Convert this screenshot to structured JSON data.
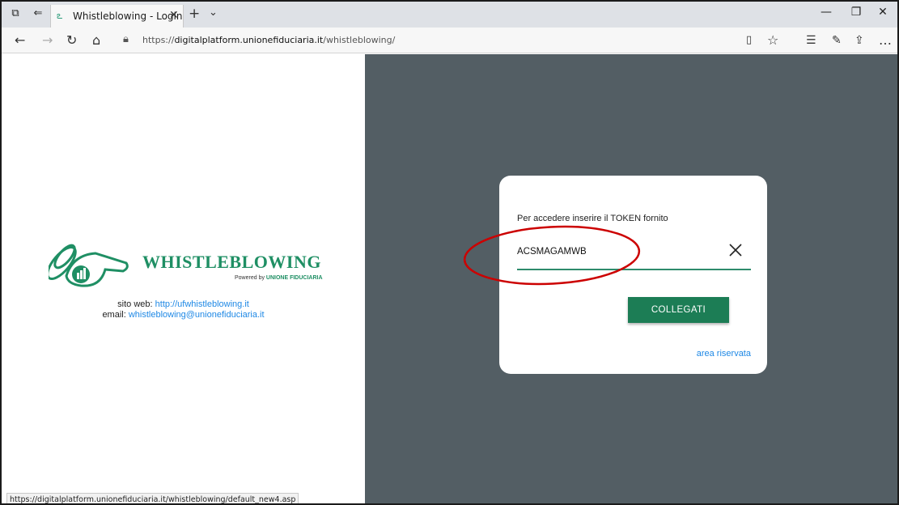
{
  "browser": {
    "tab_title": "Whistleblowing - Login",
    "url_prefix": "https://",
    "url_host": "digitalplatform.unionefiduciaria.it",
    "url_path": "/whistleblowing/",
    "status_url": "https://digitalplatform.unionefiduciaria.it/whistleblowing/default_new4.asp"
  },
  "brand": {
    "name": "WHISTLEBLOWING",
    "powered_by": "Powered by",
    "powered_brand": "UNIONE FIDUCIARIA",
    "color": "#1f8f64"
  },
  "contact": {
    "site_label": "sito web:",
    "site_link": "http://ufwhistleblowing.it",
    "email_label": "email:",
    "email_link": "whistleblowing@unionefiduciaria.it"
  },
  "login": {
    "instruction": "Per accedere inserire il TOKEN fornito",
    "token_value": "ACSMAGAMWB",
    "connect_label": "COLLEGATI",
    "reserved_area_label": "area riservata"
  },
  "colors": {
    "accent": "#1c7d55",
    "background_panel": "#535e64",
    "link": "#1e88e5",
    "annotation": "#cc0000"
  }
}
